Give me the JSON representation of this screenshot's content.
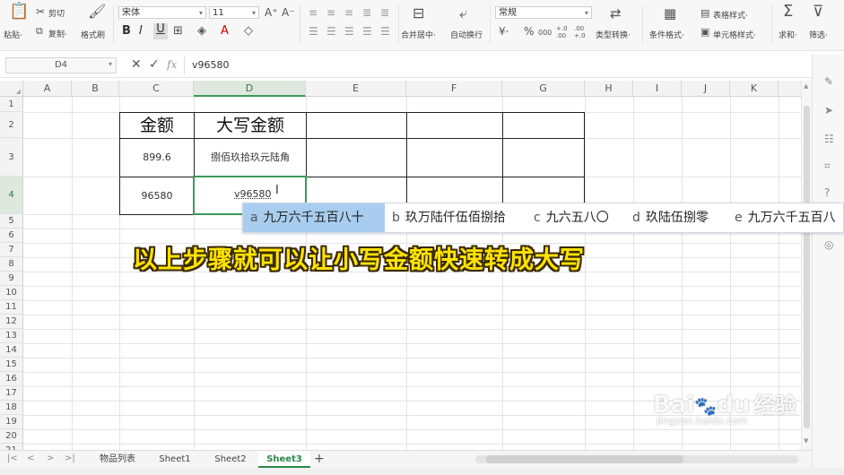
{
  "ribbon": {
    "paste_label": "粘贴·",
    "cut_label": "剪切",
    "copy_label": "复制·",
    "format_painter_label": "格式刷",
    "font_name": "宋体",
    "font_size": "11",
    "merge_center_label": "合并居中·",
    "wrap_text_label": "自动换行",
    "number_format": "常规",
    "type_convert_label": "类型转换·",
    "cond_format_label": "条件格式·",
    "table_style_label": "表格样式·",
    "cell_style_label": "单元格样式·",
    "sum_label": "求和·",
    "filter_label": "筛选·",
    "bold": "B",
    "italic": "I",
    "underline": "U",
    "percent": "%",
    "thousands": "000",
    "inc_decimal": "+.0 .00",
    "dec_decimal": ".00 +.0"
  },
  "formula_bar": {
    "name_box": "D4",
    "cancel": "✕",
    "confirm": "✓",
    "fx": "fx",
    "content": "v96580"
  },
  "grid": {
    "columns": [
      "A",
      "B",
      "C",
      "D",
      "E",
      "F",
      "G",
      "H",
      "I",
      "J",
      "K"
    ],
    "rows": [
      "1",
      "2",
      "3",
      "4",
      "5",
      "6",
      "7",
      "8",
      "9",
      "10",
      "11",
      "12",
      "13",
      "14",
      "15",
      "16",
      "17",
      "18",
      "19",
      "20",
      "21"
    ],
    "cells": {
      "C2": "金额",
      "D2": "大写金额",
      "C3": "899.6",
      "D3": "捌佰玖拾玖元陆角",
      "C4": "96580",
      "D4": "v96580"
    }
  },
  "ime": {
    "candidates": [
      {
        "key": "a",
        "text": "九万六千五百八十"
      },
      {
        "key": "b",
        "text": "玖万陆仟伍佰捌拾"
      },
      {
        "key": "c",
        "text": "九六五八〇"
      },
      {
        "key": "d",
        "text": "玖陆伍捌零"
      },
      {
        "key": "e",
        "text": "九万六千五百八"
      }
    ]
  },
  "caption": "以上步骤就可以让小写金额快速转成大写",
  "sheets": {
    "tabs": [
      "物品列表",
      "Sheet1",
      "Sheet2",
      "Sheet3"
    ],
    "active": "Sheet3",
    "add": "+"
  },
  "watermark": {
    "brand": "Bai",
    "brand2": "du",
    "brand3": "经验",
    "url": "jingyan.baidu.com"
  },
  "colors": {
    "accent": "#2a8a4a",
    "ime_highlight": "#a8cdef",
    "caption_fill": "#ffe400",
    "cell_border": "#222222"
  }
}
